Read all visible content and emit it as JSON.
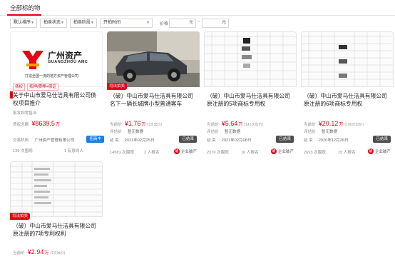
{
  "header": {
    "title": "全部标的物"
  },
  "filters": {
    "subject_type": "默认排序",
    "status": "拍卖状态",
    "stage": "拍卖阶段",
    "time": "开拍时间",
    "price_label": "价格",
    "price_min_unit": "元",
    "price_max_unit": "元",
    "dash": "-"
  },
  "cards": [
    {
      "corner_tag": "",
      "logo": {
        "cn": "广州资产",
        "en": "GUANGZHOU AMC",
        "slogan": "打造全国一流的地方资产管理公司"
      },
      "badges": [
        "债权",
        "抵押/质押+保证"
      ],
      "name": "关于中山市爱马仕洁具有限公司债权项目推介",
      "sub": "批发和零售业",
      "price_label": "债权总额",
      "price": "¥8639.5",
      "price_unit": "万",
      "org_label": "交易机构",
      "org": "广州资产管理有限公司",
      "status": "招商中",
      "views": "139 次围观",
      "reports": "1 有意向人"
    },
    {
      "corner_tag": "司法拍卖",
      "name": "（破）中山市爱马仕洁具有限公司名下一辆长城牌小型普通客车",
      "price_label": "当前价",
      "price": "¥1.76",
      "price_unit": "万",
      "price_extra": "(1次出价)",
      "eval_label": "评估价",
      "eval": "暂无数据",
      "end_label": "结    束",
      "end": "2021年02月25日",
      "status": "已结束",
      "views": "14581 次围观",
      "reports": "2 人报名",
      "cap": "企业破产"
    },
    {
      "corner_tag": "",
      "name": "（破）中山市爱马仕洁具有限公司原注册的5项商标专用权",
      "price_label": "当前价",
      "price": "¥5.64",
      "price_unit": "万",
      "price_extra": "(141次出价)",
      "eval_label": "评估价",
      "eval": "暂无数据",
      "end_label": "结    束",
      "end": "2021年02月08日",
      "status": "已结束",
      "views": "2370 次围观",
      "reports": "16 人报名",
      "cap": "企业破产"
    },
    {
      "corner_tag": "",
      "name": "（破）中山市爱马仕洁具有限公司原注册的6项商标专用权",
      "price_label": "当前价",
      "price": "¥20.12",
      "price_unit": "万",
      "price_extra": "(196次出价)",
      "eval_label": "评估价",
      "eval": "暂无数据",
      "end_label": "结    束",
      "end": "2020年12月26日",
      "status": "已结束",
      "views": "2693 次围观",
      "reports": "15 人报名",
      "cap": "企业破产"
    },
    {
      "corner_tag": "司法拍卖",
      "name": "（破）中山市爱马仕洁具有限公司原注册的7项专利权利",
      "price_label": "当前价",
      "price": "¥2.94",
      "price_unit": "万",
      "price_extra": "(1次出价)"
    }
  ],
  "colors": {
    "accent": "#e60012",
    "status_dark": "#4d4d4d",
    "status_blue": "#1a7de8"
  },
  "icons": {
    "cap": "bankruptcy-icon",
    "dropdown": "chevron-down-icon"
  }
}
